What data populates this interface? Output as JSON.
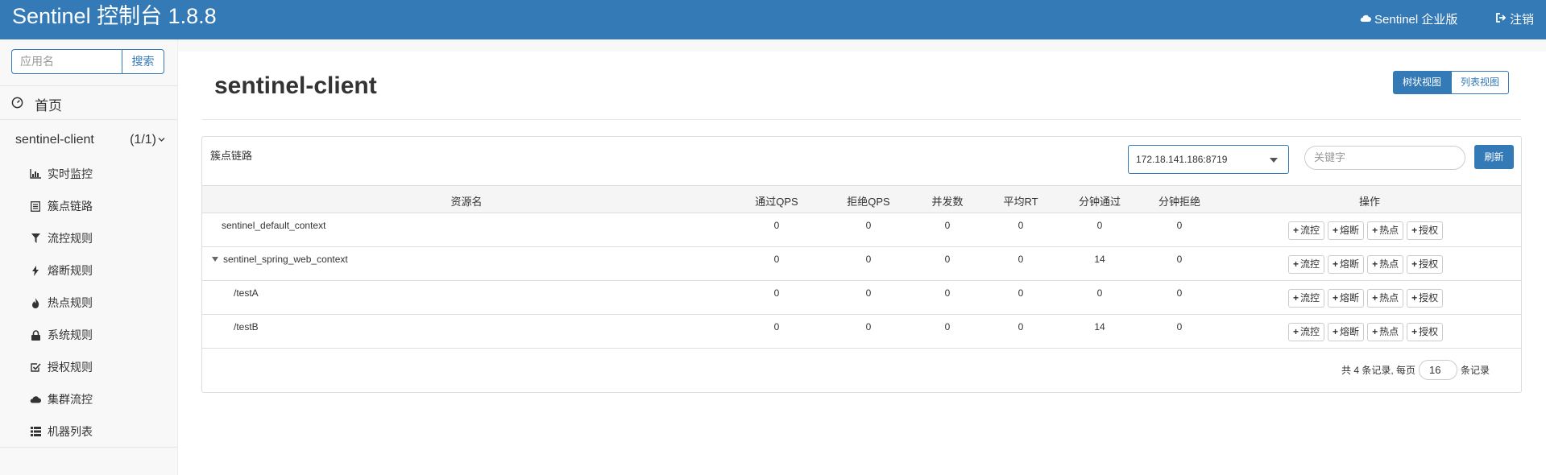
{
  "header": {
    "brand": "Sentinel 控制台 1.8.8",
    "enterprise_label": "Sentinel 企业版",
    "logout_label": "注销"
  },
  "sidebar": {
    "search_placeholder": "应用名",
    "search_button": "搜索",
    "home_label": "首页",
    "app_name": "sentinel-client",
    "app_count": "(1/1)",
    "items": [
      {
        "label": "实时监控",
        "icon": "bar-chart-icon"
      },
      {
        "label": "簇点链路",
        "icon": "list-icon"
      },
      {
        "label": "流控规则",
        "icon": "filter-icon"
      },
      {
        "label": "熔断规则",
        "icon": "bolt-icon"
      },
      {
        "label": "热点规则",
        "icon": "fire-icon"
      },
      {
        "label": "系统规则",
        "icon": "lock-icon"
      },
      {
        "label": "授权规则",
        "icon": "check-square-icon"
      },
      {
        "label": "集群流控",
        "icon": "cloud-icon"
      },
      {
        "label": "机器列表",
        "icon": "th-list-icon"
      }
    ]
  },
  "main": {
    "title": "sentinel-client",
    "view_tree": "树状视图",
    "view_list": "列表视图",
    "panel_title": "簇点链路",
    "machine": "172.18.141.186:8719",
    "keyword_placeholder": "关键字",
    "refresh": "刷新",
    "columns": [
      "资源名",
      "通过QPS",
      "拒绝QPS",
      "并发数",
      "平均RT",
      "分钟通过",
      "分钟拒绝",
      "操作"
    ],
    "rows": [
      {
        "name": "sentinel_default_context",
        "pass_qps": "0",
        "block_qps": "0",
        "threads": "0",
        "avg_rt": "0",
        "min_pass": "0",
        "min_block": "0"
      },
      {
        "name": "sentinel_spring_web_context",
        "pass_qps": "0",
        "block_qps": "0",
        "threads": "0",
        "avg_rt": "0",
        "min_pass": "14",
        "min_block": "0"
      },
      {
        "name": "/testA",
        "pass_qps": "0",
        "block_qps": "0",
        "threads": "0",
        "avg_rt": "0",
        "min_pass": "0",
        "min_block": "0"
      },
      {
        "name": "/testB",
        "pass_qps": "0",
        "block_qps": "0",
        "threads": "0",
        "avg_rt": "0",
        "min_pass": "14",
        "min_block": "0"
      }
    ],
    "actions": {
      "flow": "流控",
      "degrade": "熔断",
      "param": "热点",
      "authority": "授权"
    },
    "pager": {
      "prefix": "共 4 条记录, 每页",
      "page_size": "16",
      "suffix": "条记录"
    }
  }
}
